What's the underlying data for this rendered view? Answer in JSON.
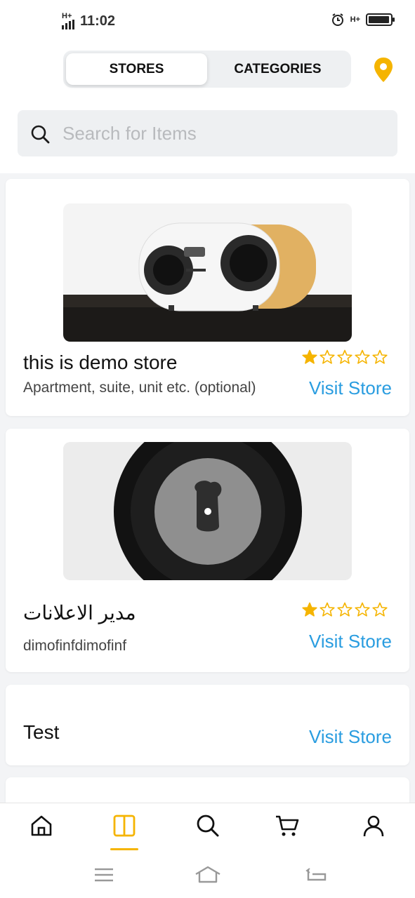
{
  "status_bar": {
    "network_left": "H+",
    "time": "11:02",
    "network_right": "H+",
    "battery_level": 0.95
  },
  "tabs": [
    {
      "label": "STORES",
      "active": true
    },
    {
      "label": "CATEGORIES",
      "active": false
    }
  ],
  "search": {
    "placeholder": "Search for Items",
    "value": ""
  },
  "stores": [
    {
      "name": "this is demo store",
      "address": "Apartment, suite, unit etc. (optional)",
      "rating": 1,
      "max_rating": 5,
      "action": "Visit Store",
      "image": "speaker"
    },
    {
      "name": "مدير الاعلانات",
      "address": "dimofinfdimofinf",
      "rating": 1,
      "max_rating": 5,
      "action": "Visit Store",
      "image": "vinyl-record"
    },
    {
      "name": "Test",
      "address": "",
      "action": "Visit Store"
    }
  ],
  "bottom_nav": [
    {
      "icon": "home-icon",
      "active": false
    },
    {
      "icon": "stores-icon",
      "active": true
    },
    {
      "icon": "search-icon",
      "active": false
    },
    {
      "icon": "cart-icon",
      "active": false
    },
    {
      "icon": "profile-icon",
      "active": false
    }
  ],
  "system_nav": [
    "menu-icon",
    "home-outline-icon",
    "back-icon"
  ],
  "colors": {
    "accent": "#f5b400",
    "link": "#2a9de0",
    "background": "#f3f4f6"
  }
}
